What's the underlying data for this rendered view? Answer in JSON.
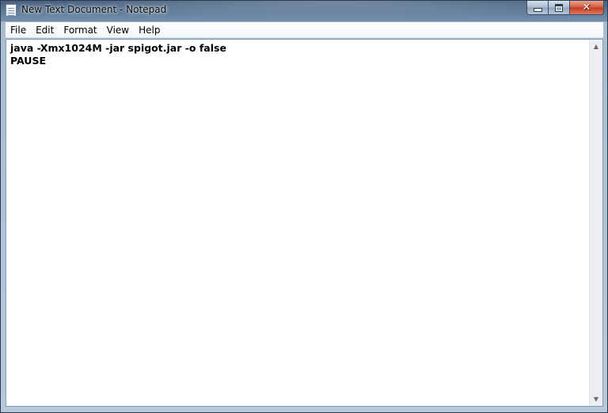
{
  "window": {
    "title": "New Text Document - Notepad",
    "icon": "notepad-icon"
  },
  "caption": {
    "minimize_icon": "minimize-icon",
    "maximize_icon": "maximize-icon",
    "close_icon": "close-icon"
  },
  "menu": {
    "items": [
      "File",
      "Edit",
      "Format",
      "View",
      "Help"
    ]
  },
  "editor": {
    "lines": [
      "java -Xmx1024M -jar spigot.jar -o false",
      "PAUSE"
    ]
  },
  "scrollbar": {
    "up_arrow": "▲",
    "down_arrow": "▼"
  },
  "colors": {
    "close_button": "#c23a1e",
    "editor_background": "#ffffff"
  }
}
